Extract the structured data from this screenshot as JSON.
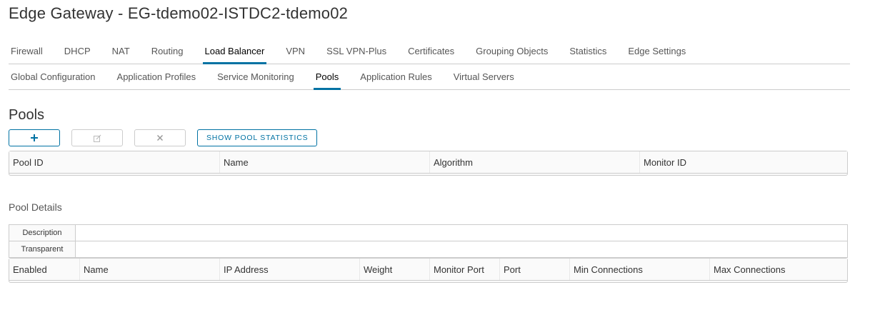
{
  "page": {
    "title": "Edge Gateway - EG-tdemo02-ISTDC2-tdemo02"
  },
  "primary_tabs": [
    {
      "label": "Firewall",
      "active": false
    },
    {
      "label": "DHCP",
      "active": false
    },
    {
      "label": "NAT",
      "active": false
    },
    {
      "label": "Routing",
      "active": false
    },
    {
      "label": "Load Balancer",
      "active": true
    },
    {
      "label": "VPN",
      "active": false
    },
    {
      "label": "SSL VPN-Plus",
      "active": false
    },
    {
      "label": "Certificates",
      "active": false
    },
    {
      "label": "Grouping Objects",
      "active": false
    },
    {
      "label": "Statistics",
      "active": false
    },
    {
      "label": "Edge Settings",
      "active": false
    }
  ],
  "secondary_tabs": [
    {
      "label": "Global Configuration",
      "active": false
    },
    {
      "label": "Application Profiles",
      "active": false
    },
    {
      "label": "Service Monitoring",
      "active": false
    },
    {
      "label": "Pools",
      "active": true
    },
    {
      "label": "Application Rules",
      "active": false
    },
    {
      "label": "Virtual Servers",
      "active": false
    }
  ],
  "pools": {
    "title": "Pools",
    "toolbar": {
      "add_icon": "plus-icon",
      "edit_icon": "edit-icon",
      "delete_icon": "close-icon",
      "stats_label": "SHOW POOL STATISTICS"
    },
    "columns": [
      "Pool ID",
      "Name",
      "Algorithm",
      "Monitor ID"
    ]
  },
  "pool_details": {
    "title": "Pool Details",
    "description_label": "Description",
    "transparent_label": "Transparent",
    "member_columns": [
      "Enabled",
      "Name",
      "IP Address",
      "Weight",
      "Monitor Port",
      "Port",
      "Min Connections",
      "Max Connections"
    ]
  },
  "colors": {
    "accent": "#0072a3",
    "border": "#cccccc"
  }
}
